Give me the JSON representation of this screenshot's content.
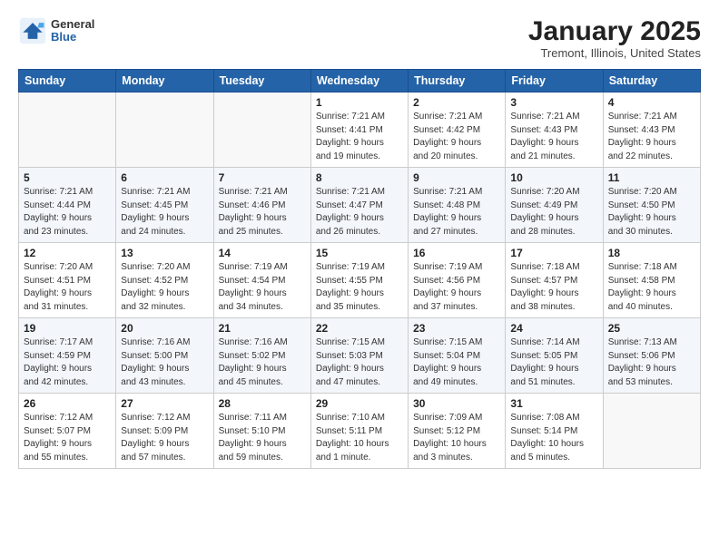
{
  "header": {
    "logo_general": "General",
    "logo_blue": "Blue",
    "title": "January 2025",
    "subtitle": "Tremont, Illinois, United States"
  },
  "weekdays": [
    "Sunday",
    "Monday",
    "Tuesday",
    "Wednesday",
    "Thursday",
    "Friday",
    "Saturday"
  ],
  "weeks": [
    [
      {
        "day": "",
        "info": ""
      },
      {
        "day": "",
        "info": ""
      },
      {
        "day": "",
        "info": ""
      },
      {
        "day": "1",
        "info": "Sunrise: 7:21 AM\nSunset: 4:41 PM\nDaylight: 9 hours\nand 19 minutes."
      },
      {
        "day": "2",
        "info": "Sunrise: 7:21 AM\nSunset: 4:42 PM\nDaylight: 9 hours\nand 20 minutes."
      },
      {
        "day": "3",
        "info": "Sunrise: 7:21 AM\nSunset: 4:43 PM\nDaylight: 9 hours\nand 21 minutes."
      },
      {
        "day": "4",
        "info": "Sunrise: 7:21 AM\nSunset: 4:43 PM\nDaylight: 9 hours\nand 22 minutes."
      }
    ],
    [
      {
        "day": "5",
        "info": "Sunrise: 7:21 AM\nSunset: 4:44 PM\nDaylight: 9 hours\nand 23 minutes."
      },
      {
        "day": "6",
        "info": "Sunrise: 7:21 AM\nSunset: 4:45 PM\nDaylight: 9 hours\nand 24 minutes."
      },
      {
        "day": "7",
        "info": "Sunrise: 7:21 AM\nSunset: 4:46 PM\nDaylight: 9 hours\nand 25 minutes."
      },
      {
        "day": "8",
        "info": "Sunrise: 7:21 AM\nSunset: 4:47 PM\nDaylight: 9 hours\nand 26 minutes."
      },
      {
        "day": "9",
        "info": "Sunrise: 7:21 AM\nSunset: 4:48 PM\nDaylight: 9 hours\nand 27 minutes."
      },
      {
        "day": "10",
        "info": "Sunrise: 7:20 AM\nSunset: 4:49 PM\nDaylight: 9 hours\nand 28 minutes."
      },
      {
        "day": "11",
        "info": "Sunrise: 7:20 AM\nSunset: 4:50 PM\nDaylight: 9 hours\nand 30 minutes."
      }
    ],
    [
      {
        "day": "12",
        "info": "Sunrise: 7:20 AM\nSunset: 4:51 PM\nDaylight: 9 hours\nand 31 minutes."
      },
      {
        "day": "13",
        "info": "Sunrise: 7:20 AM\nSunset: 4:52 PM\nDaylight: 9 hours\nand 32 minutes."
      },
      {
        "day": "14",
        "info": "Sunrise: 7:19 AM\nSunset: 4:54 PM\nDaylight: 9 hours\nand 34 minutes."
      },
      {
        "day": "15",
        "info": "Sunrise: 7:19 AM\nSunset: 4:55 PM\nDaylight: 9 hours\nand 35 minutes."
      },
      {
        "day": "16",
        "info": "Sunrise: 7:19 AM\nSunset: 4:56 PM\nDaylight: 9 hours\nand 37 minutes."
      },
      {
        "day": "17",
        "info": "Sunrise: 7:18 AM\nSunset: 4:57 PM\nDaylight: 9 hours\nand 38 minutes."
      },
      {
        "day": "18",
        "info": "Sunrise: 7:18 AM\nSunset: 4:58 PM\nDaylight: 9 hours\nand 40 minutes."
      }
    ],
    [
      {
        "day": "19",
        "info": "Sunrise: 7:17 AM\nSunset: 4:59 PM\nDaylight: 9 hours\nand 42 minutes."
      },
      {
        "day": "20",
        "info": "Sunrise: 7:16 AM\nSunset: 5:00 PM\nDaylight: 9 hours\nand 43 minutes."
      },
      {
        "day": "21",
        "info": "Sunrise: 7:16 AM\nSunset: 5:02 PM\nDaylight: 9 hours\nand 45 minutes."
      },
      {
        "day": "22",
        "info": "Sunrise: 7:15 AM\nSunset: 5:03 PM\nDaylight: 9 hours\nand 47 minutes."
      },
      {
        "day": "23",
        "info": "Sunrise: 7:15 AM\nSunset: 5:04 PM\nDaylight: 9 hours\nand 49 minutes."
      },
      {
        "day": "24",
        "info": "Sunrise: 7:14 AM\nSunset: 5:05 PM\nDaylight: 9 hours\nand 51 minutes."
      },
      {
        "day": "25",
        "info": "Sunrise: 7:13 AM\nSunset: 5:06 PM\nDaylight: 9 hours\nand 53 minutes."
      }
    ],
    [
      {
        "day": "26",
        "info": "Sunrise: 7:12 AM\nSunset: 5:07 PM\nDaylight: 9 hours\nand 55 minutes."
      },
      {
        "day": "27",
        "info": "Sunrise: 7:12 AM\nSunset: 5:09 PM\nDaylight: 9 hours\nand 57 minutes."
      },
      {
        "day": "28",
        "info": "Sunrise: 7:11 AM\nSunset: 5:10 PM\nDaylight: 9 hours\nand 59 minutes."
      },
      {
        "day": "29",
        "info": "Sunrise: 7:10 AM\nSunset: 5:11 PM\nDaylight: 10 hours\nand 1 minute."
      },
      {
        "day": "30",
        "info": "Sunrise: 7:09 AM\nSunset: 5:12 PM\nDaylight: 10 hours\nand 3 minutes."
      },
      {
        "day": "31",
        "info": "Sunrise: 7:08 AM\nSunset: 5:14 PM\nDaylight: 10 hours\nand 5 minutes."
      },
      {
        "day": "",
        "info": ""
      }
    ]
  ]
}
